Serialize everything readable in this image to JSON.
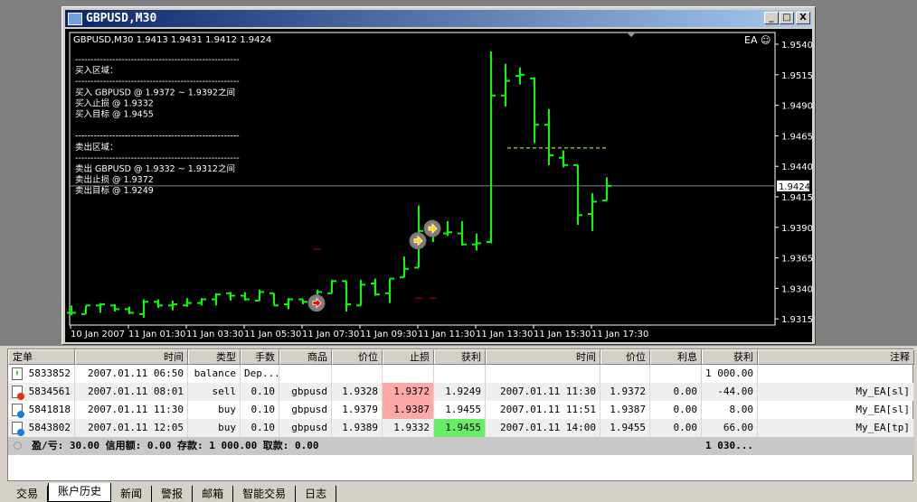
{
  "window": {
    "title": "GBPUSD,M30",
    "buttons": [
      "_",
      "□",
      "X"
    ]
  },
  "chart": {
    "header": "GBPUSD,M30  1.9413 1.9431 1.9412 1.9424",
    "ea_label": "EA ☺",
    "current_price": "1.9424",
    "comment_lines": [
      "-----------------------------------------------------",
      "买入区域：",
      "-----------------------------------------------------",
      "买入  GBPUSD @ 1.9372 ~ 1.9392之间",
      "买入止损  @ 1.9332",
      "买入目标  @ 1.9455",
      "",
      "-----------------------------------------------------",
      " 卖出区域：",
      "-----------------------------------------------------",
      "卖出  GBPUSD @ 1.9332 ~ 1.9312之间",
      "卖出止损  @ 1.9372",
      "卖出目标 @ 1.9249"
    ],
    "colors": {
      "bars": "#00ff00",
      "background": "#000000",
      "target_line": "#ffff00",
      "sl_marks": "#ff0000"
    }
  },
  "chart_data": {
    "type": "ohlc",
    "ylim": [
      1.9305,
      1.955
    ],
    "y_ticks": [
      "1.9540",
      "1.9515",
      "1.9490",
      "1.9465",
      "1.9440",
      "1.9415",
      "1.9390",
      "1.9365",
      "1.9340",
      "1.9315"
    ],
    "x_ticks": [
      {
        "bar": 0,
        "label": "10 Jan 2007"
      },
      {
        "bar": 4,
        "label": "11 Jan 01:30"
      },
      {
        "bar": 8,
        "label": "11 Jan 03:30"
      },
      {
        "bar": 12,
        "label": "11 Jan 05:30"
      },
      {
        "bar": 16,
        "label": "11 Jan 07:30"
      },
      {
        "bar": 20,
        "label": "11 Jan 09:30"
      },
      {
        "bar": 24,
        "label": "11 Jan 11:30"
      },
      {
        "bar": 28,
        "label": "11 Jan 13:30"
      },
      {
        "bar": 32,
        "label": "11 Jan 15:30"
      },
      {
        "bar": 36,
        "label": "11 Jan 17:30"
      }
    ],
    "ohlc": [
      [
        1.932,
        1.9326,
        1.9318,
        1.932
      ],
      [
        1.9319,
        1.9326,
        1.9319,
        1.9326
      ],
      [
        1.9326,
        1.9328,
        1.932,
        1.9327
      ],
      [
        1.9326,
        1.9327,
        1.9321,
        1.9323
      ],
      [
        1.9323,
        1.9325,
        1.9319,
        1.932
      ],
      [
        1.9319,
        1.9331,
        1.9316,
        1.9329
      ],
      [
        1.9329,
        1.9331,
        1.9324,
        1.9326
      ],
      [
        1.9326,
        1.933,
        1.9322,
        1.9327
      ],
      [
        1.9326,
        1.9332,
        1.9325,
        1.9328
      ],
      [
        1.9328,
        1.9332,
        1.9326,
        1.9331
      ],
      [
        1.9331,
        1.9336,
        1.9326,
        1.9335
      ],
      [
        1.9336,
        1.9337,
        1.933,
        1.9334
      ],
      [
        1.9334,
        1.9337,
        1.933,
        1.9331
      ],
      [
        1.933,
        1.9339,
        1.933,
        1.9337
      ],
      [
        1.9336,
        1.9336,
        1.9326,
        1.9326
      ],
      [
        1.9327,
        1.9332,
        1.9323,
        1.9331
      ],
      [
        1.9331,
        1.9331,
        1.9327,
        1.9329
      ],
      [
        1.9329,
        1.9339,
        1.9324,
        1.9337
      ],
      [
        1.9336,
        1.9347,
        1.9336,
        1.9346
      ],
      [
        1.9346,
        1.9346,
        1.9321,
        1.9327
      ],
      [
        1.9326,
        1.9347,
        1.9326,
        1.9343
      ],
      [
        1.9344,
        1.9348,
        1.9334,
        1.9335
      ],
      [
        1.9336,
        1.9348,
        1.9328,
        1.9348
      ],
      [
        1.9349,
        1.9366,
        1.9349,
        1.9356
      ],
      [
        1.9357,
        1.9408,
        1.9357,
        1.9387
      ],
      [
        1.9392,
        1.9396,
        1.9378,
        1.9385
      ],
      [
        1.9385,
        1.9395,
        1.9383,
        1.9386
      ],
      [
        1.9385,
        1.9395,
        1.9375,
        1.9376
      ],
      [
        1.9376,
        1.9385,
        1.9371,
        1.9377
      ],
      [
        1.9378,
        1.9534,
        1.9377,
        1.9498
      ],
      [
        1.9498,
        1.9524,
        1.9489,
        1.951
      ],
      [
        1.9514,
        1.9521,
        1.9507,
        1.9515
      ],
      [
        1.9512,
        1.9513,
        1.9459,
        1.9474
      ],
      [
        1.9474,
        1.9487,
        1.9441,
        1.9449
      ],
      [
        1.9447,
        1.9453,
        1.9439,
        1.9441
      ],
      [
        1.9441,
        1.9441,
        1.9392,
        1.94
      ],
      [
        1.9401,
        1.9418,
        1.9387,
        1.9411
      ],
      [
        1.9412,
        1.9431,
        1.9412,
        1.9424
      ]
    ],
    "trade_markers": [
      {
        "bar": 17,
        "price": 1.9328,
        "type": "sell"
      },
      {
        "bar": 24,
        "price": 1.9379,
        "type": "buy"
      },
      {
        "bar": 25,
        "price": 1.9389,
        "type": "buy"
      }
    ],
    "sl_marks": [
      {
        "bar": 17,
        "price": 1.9372
      },
      {
        "bar": 24,
        "price": 1.9332
      },
      {
        "bar": 25,
        "price": 1.9332
      }
    ],
    "target_line": {
      "from_bar": 30,
      "to_bar": 37,
      "price": 1.9455
    },
    "current_price": 1.9424
  },
  "terminal": {
    "columns": [
      "定单",
      "时间",
      "类型",
      "手数",
      "商品",
      "价位",
      "止损",
      "获利",
      "时间",
      "价位",
      "利息",
      "获利",
      "注释"
    ],
    "rows": [
      {
        "icon": "deposit",
        "cells": [
          "5833852",
          "2007.01.11 06:50",
          "balance",
          "Dep...",
          "",
          "",
          "",
          "",
          "",
          "",
          "",
          "1 000.00",
          ""
        ]
      },
      {
        "icon": "sell",
        "cells": [
          "5834561",
          "2007.01.11 08:01",
          "sell",
          "0.10",
          "gbpusd",
          "1.9328",
          "1.9372",
          "1.9249",
          "2007.01.11 11:30",
          "1.9372",
          "0.00",
          "-44.00",
          "My_EA[sl]"
        ],
        "hl": {
          "6": "#ffa8a8"
        }
      },
      {
        "icon": "buy",
        "cells": [
          "5841818",
          "2007.01.11 11:30",
          "buy",
          "0.10",
          "gbpusd",
          "1.9379",
          "1.9387",
          "1.9455",
          "2007.01.11 11:51",
          "1.9387",
          "0.00",
          "8.00",
          "My_EA[sl]"
        ],
        "hl": {
          "6": "#ffa8a8"
        }
      },
      {
        "icon": "buy",
        "cells": [
          "5843802",
          "2007.01.11 12:05",
          "buy",
          "0.10",
          "gbpusd",
          "1.9389",
          "1.9332",
          "1.9455",
          "2007.01.11 14:00",
          "1.9455",
          "0.00",
          "66.00",
          "My_EA[tp]"
        ],
        "hl": {
          "7": "#66ee66"
        }
      }
    ],
    "summary": "盈/亏: 30.00  信用额: 0.00  存款: 1 000.00  取款: 0.00",
    "summary_total": "1 030...",
    "tabs": [
      "交易",
      "账户历史",
      "新闻",
      "警报",
      "邮箱",
      "智能交易",
      "日志"
    ],
    "active_tab": 1
  }
}
